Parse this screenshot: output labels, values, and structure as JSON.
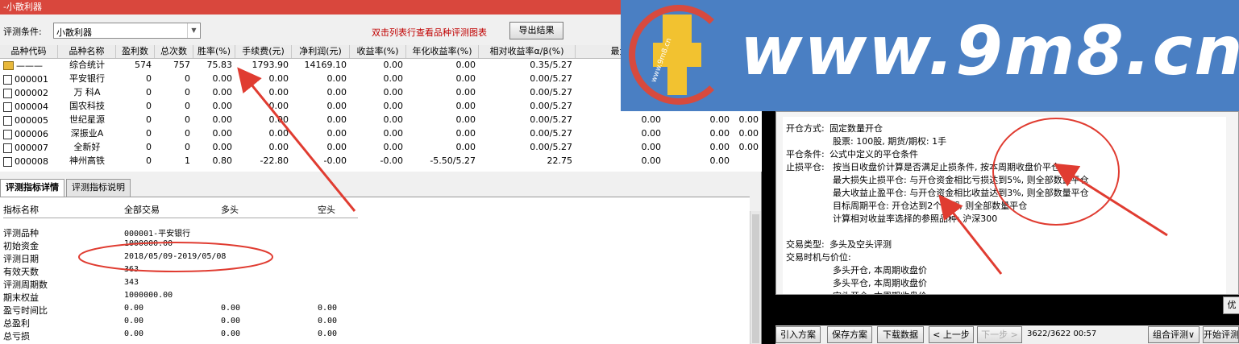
{
  "window": {
    "title": "小散利器"
  },
  "toolbar": {
    "label": "评测条件:",
    "combo_value": "小散利器",
    "hint": "双击列表行查看品种评测图表",
    "export_label": "导出结果"
  },
  "table": {
    "headers": [
      "品种代码",
      "品种名称",
      "盈利数",
      "总次数",
      "胜率(%)",
      "手续费(元)",
      "净利润(元)",
      "收益率(%)",
      "年化收益率(%)",
      "相对收益率α/β(%)",
      "最大",
      "",
      ""
    ],
    "rows": [
      {
        "code": "———",
        "name": "综合统计",
        "win": "574",
        "total": "757",
        "rate": "75.83",
        "fee": "1793.90",
        "profit": "14169.10",
        "yield": "0.00",
        "annual": "0.00",
        "rel": "0.35/5.27",
        "max": "",
        "x1": "",
        "x2": ""
      },
      {
        "code": "000001",
        "name": "平安银行",
        "win": "0",
        "total": "0",
        "rate": "0.00",
        "fee": "0.00",
        "profit": "0.00",
        "yield": "0.00",
        "annual": "0.00",
        "rel": "0.00/5.27",
        "max": "",
        "x1": "",
        "x2": ""
      },
      {
        "code": "000002",
        "name": "万 科A",
        "win": "0",
        "total": "0",
        "rate": "0.00",
        "fee": "0.00",
        "profit": "0.00",
        "yield": "0.00",
        "annual": "0.00",
        "rel": "0.00/5.27",
        "max": "",
        "x1": "",
        "x2": ""
      },
      {
        "code": "000004",
        "name": "国农科技",
        "win": "0",
        "total": "0",
        "rate": "0.00",
        "fee": "0.00",
        "profit": "0.00",
        "yield": "0.00",
        "annual": "0.00",
        "rel": "0.00/5.27",
        "max": "",
        "x1": "",
        "x2": ""
      },
      {
        "code": "000005",
        "name": "世纪星源",
        "win": "0",
        "total": "0",
        "rate": "0.00",
        "fee": "0.00",
        "profit": "0.00",
        "yield": "0.00",
        "annual": "0.00",
        "rel": "0.00/5.27",
        "max": "0.00",
        "x1": "0.00",
        "x2": "0.00"
      },
      {
        "code": "000006",
        "name": "深振业A",
        "win": "0",
        "total": "0",
        "rate": "0.00",
        "fee": "0.00",
        "profit": "0.00",
        "yield": "0.00",
        "annual": "0.00",
        "rel": "0.00/5.27",
        "max": "0.00",
        "x1": "0.00",
        "x2": "0.00"
      },
      {
        "code": "000007",
        "name": "全新好",
        "win": "0",
        "total": "0",
        "rate": "0.00",
        "fee": "0.00",
        "profit": "0.00",
        "yield": "0.00",
        "annual": "0.00",
        "rel": "0.00/5.27",
        "max": "0.00",
        "x1": "0.00",
        "x2": "0.00"
      },
      {
        "code": "000008",
        "name": "神州高铁",
        "win": "0",
        "total": "1",
        "rate": "0.80",
        "fee": "-22.80",
        "profit": "-0.00",
        "yield": "-0.00",
        "annual": "-5.50/5.27",
        "rel": "22.75",
        "max": "0.00",
        "x1": "0.00",
        "x2": ""
      }
    ]
  },
  "tabs": [
    "评测指标详情",
    "评测指标说明"
  ],
  "detail": {
    "headers": [
      "指标名称",
      "全部交易",
      "多头",
      "空头"
    ],
    "rows": [
      {
        "name": "评测品种",
        "all": "000001-平安银行",
        "long": "",
        "short": ""
      },
      {
        "name": "初始资金",
        "all": "1000000.00",
        "long": "",
        "short": ""
      },
      {
        "name": "评测日期",
        "all": "2018/05/09-2019/05/08",
        "long": "",
        "short": ""
      },
      {
        "name": "有效天数",
        "all": "363",
        "long": "",
        "short": ""
      },
      {
        "name": "评测周期数",
        "all": "343",
        "long": "",
        "short": ""
      },
      {
        "name": "期末权益",
        "all": "1000000.00",
        "long": "",
        "short": ""
      },
      {
        "name": "盈亏时间比",
        "all": "0.00",
        "long": "0.00",
        "short": "0.00"
      },
      {
        "name": "总盈利",
        "all": "0.00",
        "long": "0.00",
        "short": "0.00"
      },
      {
        "name": "总亏损",
        "all": "0.00",
        "long": "0.00",
        "short": "0.00"
      }
    ]
  },
  "right": {
    "lines": [
      {
        "k": "开仓方式:",
        "v": "固定数量开仓"
      },
      {
        "k": "",
        "v": "股票: 100股, 期货/期权: 1手"
      },
      {
        "k": "平仓条件:",
        "v": "公式中定义的平仓条件"
      },
      {
        "k": "止损平仓:",
        "v": "按当日收盘价计算是否满足止损条件, 按本周期收盘价平仓"
      },
      {
        "k": "",
        "v": "最大损失止损平仓: 与开仓资金相比亏损达到5%, 则全部数量平仓"
      },
      {
        "k": "",
        "v": "最大收益止盈平仓: 与开仓资金相比收益达到3%, 则全部数量平仓"
      },
      {
        "k": "",
        "v": "目标周期平仓: 开仓达到2个周期, 则全部数量平仓"
      },
      {
        "k": "",
        "v": "计算相对收益率选择的参照品种: 沪深300"
      },
      {
        "k": "交易类型:",
        "v": "多头及空头评测"
      },
      {
        "k": "交易时机与价位:",
        "v": ""
      },
      {
        "k": "",
        "v": "多头开仓, 本周期收盘价"
      },
      {
        "k": "",
        "v": "多头平仓, 本周期收盘价"
      },
      {
        "k": "",
        "v": "空头开仓, 本周期收盘价"
      }
    ],
    "opt_label": "优化",
    "bottom": {
      "import": "引入方案",
      "save": "保存方案",
      "download": "下载数据",
      "prev": "< 上一步",
      "next": "下一步 >",
      "status": "3622/3622 00:57",
      "combo_eval": "组合评测∨",
      "start": "开始评测"
    }
  },
  "watermark": {
    "text": "www.9m8.cn",
    "small": "www.9m8.cn",
    "color": "#4a7fc3",
    "accent": "#d74a3e"
  },
  "colors": {
    "title_bar": "#d9473d",
    "hint": "#c00000",
    "annotation": "#e03c31"
  }
}
